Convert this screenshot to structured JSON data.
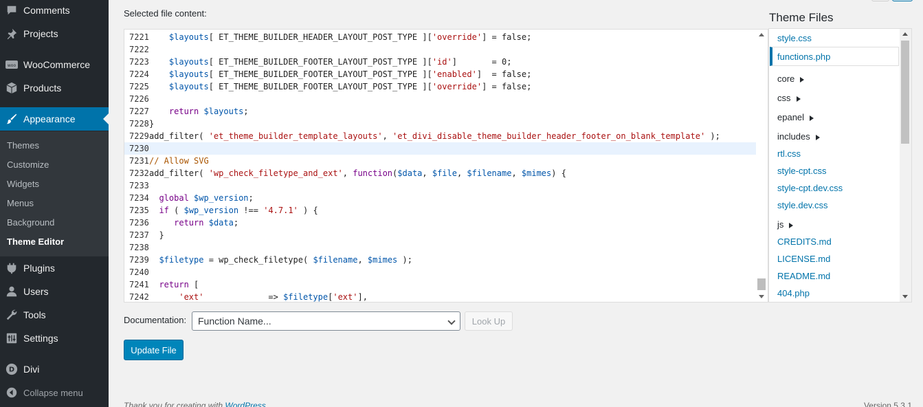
{
  "sidebar": {
    "items": [
      {
        "label": "Comments",
        "icon": "comment-icon"
      },
      {
        "label": "Projects",
        "icon": "pin-icon"
      },
      {
        "label": "WooCommerce",
        "icon": "woo-icon"
      },
      {
        "label": "Products",
        "icon": "box-icon"
      },
      {
        "label": "Appearance",
        "icon": "brush-icon"
      },
      {
        "label": "Plugins",
        "icon": "plug-icon"
      },
      {
        "label": "Users",
        "icon": "user-icon"
      },
      {
        "label": "Tools",
        "icon": "wrench-icon"
      },
      {
        "label": "Settings",
        "icon": "settings-icon"
      },
      {
        "label": "Divi",
        "icon": "divi-icon"
      },
      {
        "label": "Collapse menu",
        "icon": "collapse-icon"
      }
    ],
    "submenu": [
      "Themes",
      "Customize",
      "Widgets",
      "Menus",
      "Background",
      "Theme Editor"
    ],
    "active_submenu": "Theme Editor"
  },
  "main": {
    "content_label": "Selected file content:",
    "code_lines": [
      {
        "n": "7221",
        "t": "    $layouts[ ET_THEME_BUILDER_HEADER_LAYOUT_POST_TYPE ]['override'] = false;"
      },
      {
        "n": "7222",
        "t": ""
      },
      {
        "n": "7223",
        "t": "    $layouts[ ET_THEME_BUILDER_FOOTER_LAYOUT_POST_TYPE ]['id']       = 0;"
      },
      {
        "n": "7224",
        "t": "    $layouts[ ET_THEME_BUILDER_FOOTER_LAYOUT_POST_TYPE ]['enabled']  = false;"
      },
      {
        "n": "7225",
        "t": "    $layouts[ ET_THEME_BUILDER_FOOTER_LAYOUT_POST_TYPE ]['override'] = false;"
      },
      {
        "n": "7226",
        "t": ""
      },
      {
        "n": "7227",
        "t": "    return $layouts;"
      },
      {
        "n": "7228",
        "t": "}"
      },
      {
        "n": "7229",
        "t": "add_filter( 'et_theme_builder_template_layouts', 'et_divi_disable_theme_builder_header_footer_on_blank_template' );"
      },
      {
        "n": "7230",
        "t": ""
      },
      {
        "n": "7231",
        "t": "// Allow SVG"
      },
      {
        "n": "7232",
        "t": "add_filter( 'wp_check_filetype_and_ext', function($data, $file, $filename, $mimes) {"
      },
      {
        "n": "7233",
        "t": ""
      },
      {
        "n": "7234",
        "t": "  global $wp_version;"
      },
      {
        "n": "7235",
        "t": "  if ( $wp_version !== '4.7.1' ) {"
      },
      {
        "n": "7236",
        "t": "     return $data;"
      },
      {
        "n": "7237",
        "t": "  }"
      },
      {
        "n": "7238",
        "t": ""
      },
      {
        "n": "7239",
        "t": "  $filetype = wp_check_filetype( $filename, $mimes );"
      },
      {
        "n": "7240",
        "t": ""
      },
      {
        "n": "7241",
        "t": "  return ["
      },
      {
        "n": "7242",
        "t": "      'ext'             => $filetype['ext'],"
      }
    ],
    "highlighted_line": "7230"
  },
  "theme_files": {
    "title": "Theme Files",
    "current": "functions.php",
    "items": [
      {
        "label": "style.css",
        "type": "file"
      },
      {
        "label": "functions.php",
        "type": "file"
      },
      {
        "label": "core",
        "type": "dir"
      },
      {
        "label": "css",
        "type": "dir"
      },
      {
        "label": "epanel",
        "type": "dir"
      },
      {
        "label": "includes",
        "type": "dir"
      },
      {
        "label": "rtl.css",
        "type": "file"
      },
      {
        "label": "style-cpt.css",
        "type": "file"
      },
      {
        "label": "style-cpt.dev.css",
        "type": "file"
      },
      {
        "label": "style.dev.css",
        "type": "file"
      },
      {
        "label": "js",
        "type": "dir"
      },
      {
        "label": "CREDITS.md",
        "type": "file"
      },
      {
        "label": "LICENSE.md",
        "type": "file"
      },
      {
        "label": "README.md",
        "type": "file"
      },
      {
        "label": "404.php",
        "type": "file"
      }
    ]
  },
  "documentation": {
    "label": "Documentation:",
    "select_value": "Function Name...",
    "lookup_label": "Look Up"
  },
  "update_button": "Update File",
  "footer": {
    "thanks_prefix": "Thank you for creating with ",
    "thanks_link": "WordPress",
    "thanks_suffix": ".",
    "version": "Version 5.3.1"
  },
  "colors": {
    "sidebar_bg": "#23282d",
    "submenu_bg": "#32373c",
    "accent": "#0073aa",
    "button_primary": "#0085ba"
  }
}
